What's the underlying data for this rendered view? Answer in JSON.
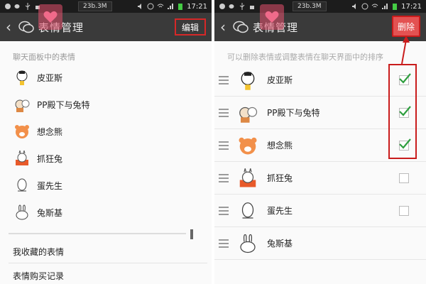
{
  "status_bar": {
    "speed": "23b.3M",
    "time": "17:21"
  },
  "left_panel": {
    "title": "表情管理",
    "edit_label": "编辑",
    "section_label": "聊天面板中的表情",
    "items": [
      {
        "label": "皮亚斯",
        "icon": "pi-ya-si-sticker-icon"
      },
      {
        "label": "PP殿下与兔特",
        "icon": "pp-rabbit-sticker-icon"
      },
      {
        "label": "想念熊",
        "icon": "missing-bear-sticker-icon"
      },
      {
        "label": "抓狂兔",
        "icon": "crazy-rabbit-sticker-icon"
      },
      {
        "label": "蛋先生",
        "icon": "mr-egg-sticker-icon"
      },
      {
        "label": "兔斯基",
        "icon": "tuzki-sticker-icon"
      }
    ],
    "menu": {
      "favorites": "我收藏的表情",
      "purchase_history": "表情购买记录"
    }
  },
  "right_panel": {
    "title": "表情管理",
    "delete_label": "删除",
    "hint": "可以删除表情或调整表情在聊天界面中的排序",
    "items": [
      {
        "label": "皮亚斯",
        "checked": true
      },
      {
        "label": "PP殿下与兔特",
        "checked": true
      },
      {
        "label": "想念熊",
        "checked": true
      },
      {
        "label": "抓狂兔",
        "checked": false
      },
      {
        "label": "蛋先生",
        "checked": false
      },
      {
        "label": "兔斯基",
        "checked": false
      }
    ]
  },
  "colors": {
    "accent_red": "#d62828",
    "check_green": "#2e9e3e",
    "titlebar": "#3a3a3a"
  }
}
